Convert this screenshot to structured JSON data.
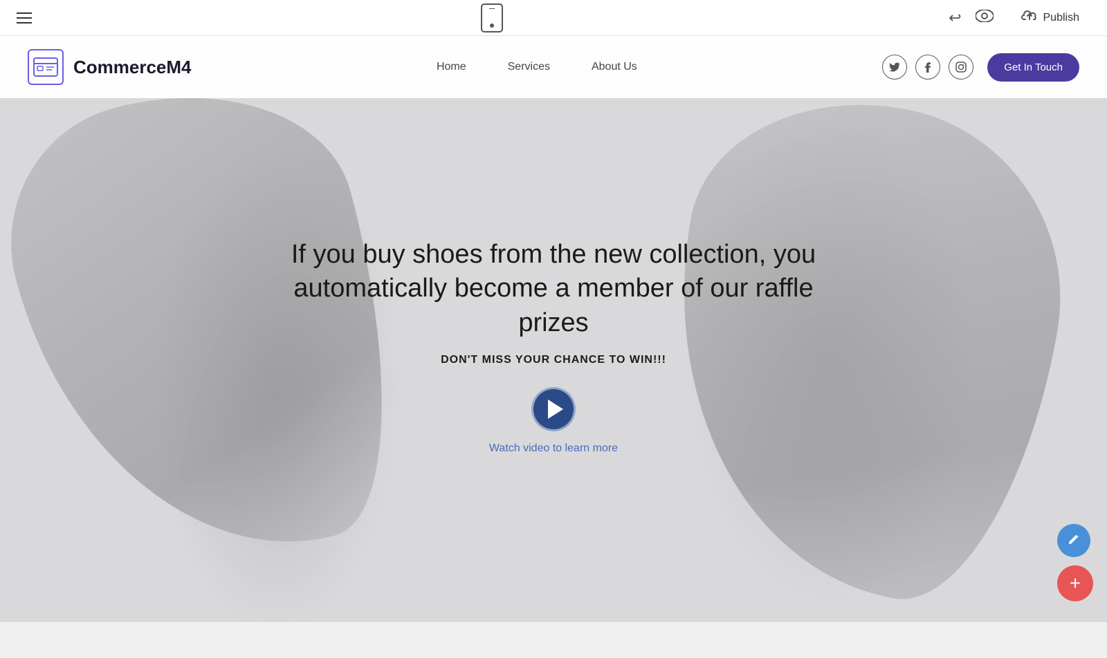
{
  "toolbar": {
    "publish_label": "Publish",
    "hamburger_aria": "Menu",
    "phone_aria": "Mobile preview",
    "undo_aria": "Undo",
    "eye_aria": "Preview",
    "cloud_aria": "Save to cloud"
  },
  "site": {
    "logo_text": "CommerceM4",
    "nav": {
      "home": "Home",
      "services": "Services",
      "about_us": "About Us"
    },
    "social": {
      "twitter": "𝕏",
      "facebook": "f",
      "instagram": "◎"
    },
    "cta_button": "Get In Touch",
    "hero": {
      "headline": "If you buy shoes from the new collection, you automatically become a member of our raffle prizes",
      "subheadline": "DON'T MISS YOUR CHANCE TO WIN!!!",
      "watch_video": "Watch video to learn more"
    }
  },
  "fab": {
    "edit_label": "✎",
    "add_label": "+"
  }
}
